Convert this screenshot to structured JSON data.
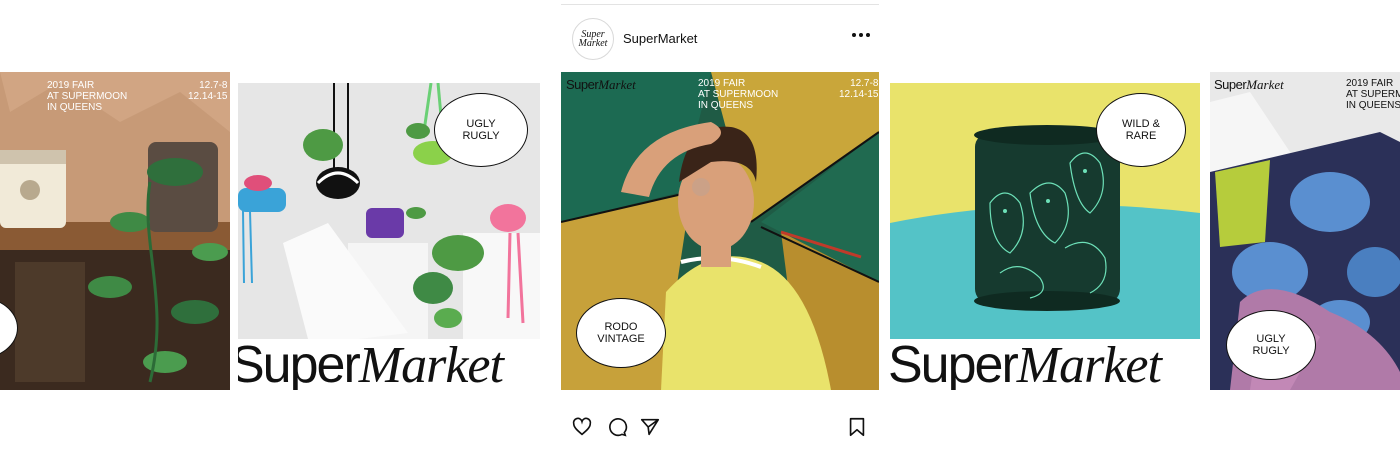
{
  "brand": {
    "wordmark_part1": "Super",
    "wordmark_part2": "Market",
    "avatar_line1": "Super",
    "avatar_line2": "Market"
  },
  "post": {
    "username": "SuperMarket",
    "event_line1": "2019 FAIR",
    "event_line2": "AT SUPERMOON",
    "event_line3": "IN QUEENS",
    "date_line1": "12.7-8",
    "date_line2": "12.14-15"
  },
  "tiles": {
    "plant_tile": {
      "event_line1": "2019 FAIR",
      "event_line2": "AT SUPERMOON",
      "event_line3": "IN QUEENS",
      "date_line1": "12.7-8",
      "date_line2": "12.14-15"
    },
    "hanging_tile": {
      "bubble_line1": "UGLY",
      "bubble_line2": "RUGLY"
    },
    "umbrella_tile": {
      "bubble_line1": "RODO",
      "bubble_line2": "VINTAGE"
    },
    "cuff_tile": {
      "bubble_line1": "WILD &",
      "bubble_line2": "RARE"
    },
    "rug_tile": {
      "event_line1": "2019 FAIR",
      "event_line2": "AT SUPERMOON",
      "event_line3": "IN QUEENS",
      "bubble_line1": "UGLY",
      "bubble_line2": "RUGLY"
    }
  },
  "icons": {
    "like": "heart-icon",
    "comment": "comment-icon",
    "share": "share-icon",
    "save": "bookmark-icon",
    "more": "more-options-icon"
  },
  "colors": {
    "green": "#1f5b45",
    "yellow": "#e9e36b",
    "teal": "#54c3c7",
    "pink": "#f2749c",
    "blue": "#3aa3d8",
    "purple": "#6a3aa8"
  }
}
